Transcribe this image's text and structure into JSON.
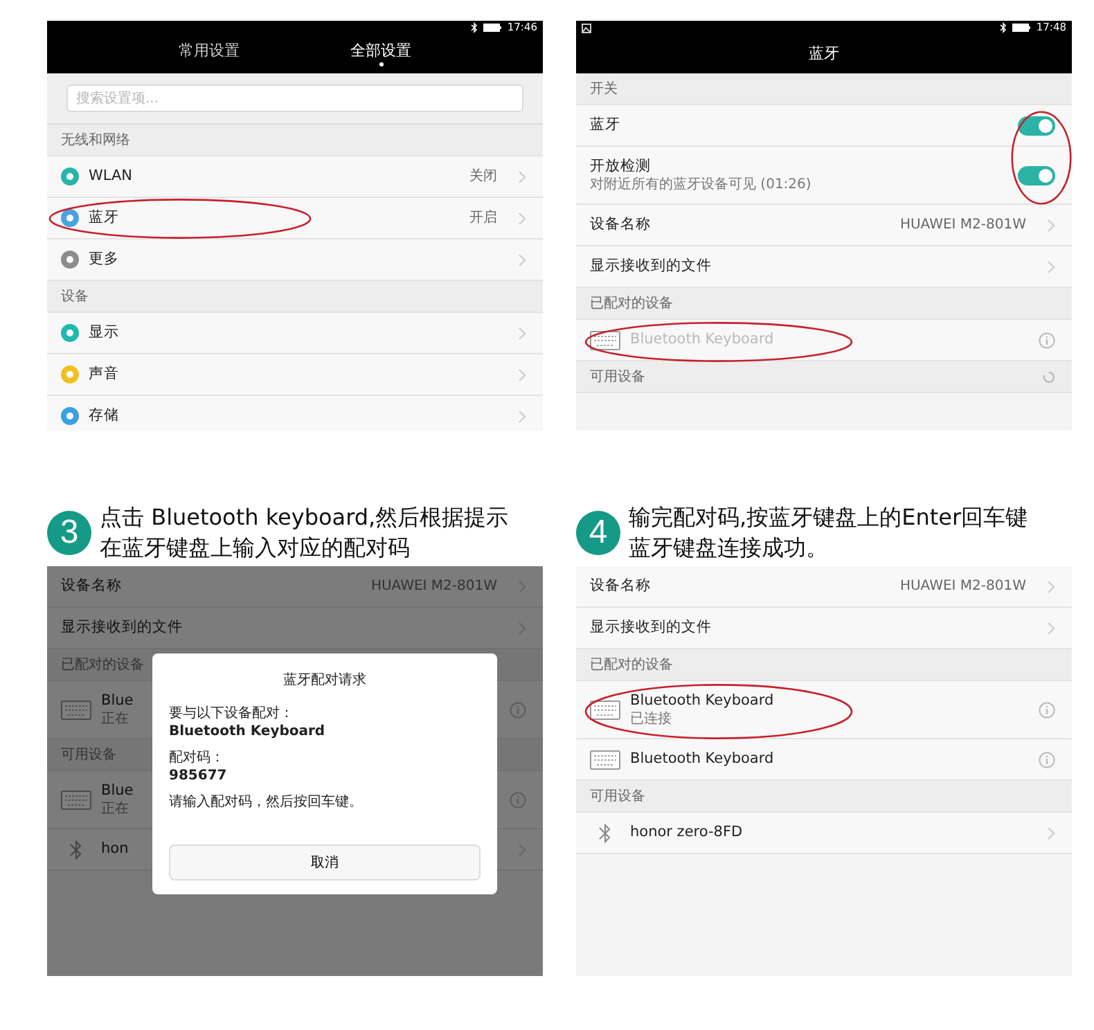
{
  "steps": [
    {
      "panel": {
        "status_bar": {
          "notification": false,
          "time": "17:46"
        },
        "tabs": [
          {
            "label": "常用设置",
            "selected": false
          },
          {
            "label": "全部设置",
            "selected": true
          }
        ],
        "search": {
          "placeholder": "搜索设置项..."
        },
        "rows": [
          {
            "kind": "section",
            "label": "无线和网络"
          },
          {
            "kind": "setting",
            "color": "#26b5a8",
            "label": "WLAN",
            "value": "关闭",
            "circled": false
          },
          {
            "kind": "setting",
            "color": "#4aa3df",
            "label": "蓝牙",
            "value": "开启",
            "circled": true
          },
          {
            "kind": "setting",
            "color": "#8c8c8c",
            "label": "更多",
            "circled": false
          },
          {
            "kind": "section",
            "label": "设备"
          },
          {
            "kind": "setting",
            "color": "#1fb8b0",
            "label": "显示",
            "circled": false
          },
          {
            "kind": "setting",
            "color": "#f0c020",
            "label": "声音",
            "circled": false
          },
          {
            "kind": "setting",
            "color": "#3aa0e0",
            "label": "存储",
            "circled": false
          }
        ]
      }
    },
    {
      "panel": {
        "status_bar": {
          "notification": true,
          "time": "17:48"
        },
        "title": "蓝牙",
        "toggles_circled": true,
        "rows": [
          {
            "kind": "section",
            "label": "开关"
          },
          {
            "kind": "toggle",
            "label": "蓝牙",
            "on": true
          },
          {
            "kind": "toggle",
            "label": "开放检测",
            "subtitle": "对附近所有的蓝牙设备可见 (01:26)",
            "on": true
          },
          {
            "kind": "setting",
            "label": "设备名称",
            "value": "HUAWEI M2-801W",
            "circled": false
          },
          {
            "kind": "setting",
            "label": "显示接收到的文件",
            "circled": false
          },
          {
            "kind": "section",
            "label": "已配对的设备"
          },
          {
            "kind": "keyboard",
            "label": "Bluetooth Keyboard",
            "disabled": true,
            "circled": true
          },
          {
            "kind": "section",
            "label": "可用设备",
            "scanning": true
          }
        ]
      }
    },
    {
      "number": "3",
      "caption": [
        "点击 Bluetooth keyboard,然后根据提示",
        "在蓝牙键盘上输入对应的配对码"
      ],
      "panel": {
        "dimmed": true,
        "rows": [
          {
            "kind": "setting",
            "label": "设备名称",
            "value": "HUAWEI M2-801W",
            "circled": false
          },
          {
            "kind": "setting",
            "label": "显示接收到的文件",
            "circled": false
          },
          {
            "kind": "section",
            "label": "已配对的设备"
          },
          {
            "kind": "keyboard",
            "label": "Blue",
            "subtitle": "正在",
            "disabled": false,
            "circled": false
          },
          {
            "kind": "section",
            "label": "可用设备"
          },
          {
            "kind": "keyboard",
            "label": "Blue",
            "subtitle": "正在",
            "disabled": false,
            "circled": false
          },
          {
            "kind": "bluetooth",
            "label": "hon"
          }
        ],
        "dialog": {
          "title": "蓝牙配对请求",
          "fields": [
            {
              "label": "要与以下设备配对：",
              "value": "Bluetooth Keyboard"
            },
            {
              "label": "配对码：",
              "value": "985677"
            }
          ],
          "message": "请输入配对码，然后按回车键。",
          "button": "取消"
        }
      }
    },
    {
      "number": "4",
      "caption": [
        "输完配对码,按蓝牙键盘上的Enter回车键",
        "蓝牙键盘连接成功。"
      ],
      "panel": {
        "rows": [
          {
            "kind": "setting",
            "label": "设备名称",
            "value": "HUAWEI M2-801W",
            "circled": false
          },
          {
            "kind": "setting",
            "label": "显示接收到的文件",
            "circled": false
          },
          {
            "kind": "section",
            "label": "已配对的设备"
          },
          {
            "kind": "keyboard",
            "label": "Bluetooth Keyboard",
            "subtitle": "已连接",
            "disabled": false,
            "circled": true
          },
          {
            "kind": "keyboard",
            "label": "Bluetooth Keyboard",
            "disabled": false,
            "circled": false
          },
          {
            "kind": "section",
            "label": "可用设备"
          },
          {
            "kind": "bluetooth",
            "label": "honor zero-8FD"
          }
        ]
      }
    }
  ]
}
